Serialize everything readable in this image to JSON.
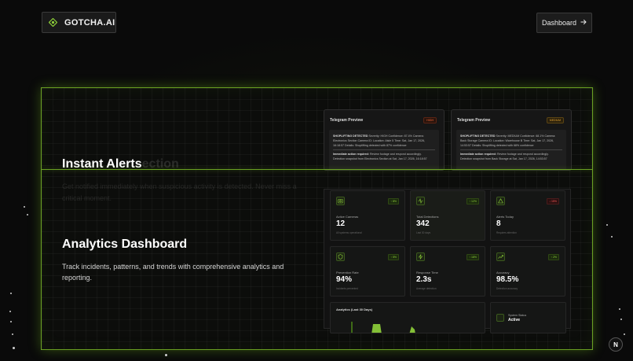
{
  "header": {
    "brand_name": "GOTCHA.AI",
    "brand_icon": "eye-diamond-icon",
    "dashboard_label": "Dashboard",
    "dashboard_icon": "arrow-right-icon"
  },
  "colors": {
    "accent": "#6aa022",
    "bright_accent": "#8fd13a",
    "danger": "#ff5a5a",
    "background": "#0b0b0b"
  },
  "prev_slide": {
    "title_visible": "Instant Alerts",
    "title_ghost": "ection",
    "description": "Get notified immediately when suspicious activity is detected. Never miss a critical moment.",
    "cards": [
      {
        "title": "Telegram Preview",
        "severity": "HIGH",
        "line1": "SHOPLIFTING DETECTED",
        "line1b": "Severity: HIGH",
        "line1c": "Confidence: 87.4%",
        "line2": "Camera: Electronics Section",
        "line2b": "Camera ID:",
        "line2c": "Location: Aisle 5",
        "line3": "Time: Sat, Jan 17, 2026, 16:18:57",
        "line3b": "Details: Shoplifting detected with 87% confidence",
        "action": "Immediate action required:",
        "action_text": "Review footage and respond accordingly.",
        "footer": "Detection snapshot from Electronics Section at Sat, Jan 17, 2026, 16:18:57"
      },
      {
        "title": "Telegram Preview",
        "severity": "MEDIUM",
        "line1": "SHOPLIFTING DETECTED",
        "line1b": "Severity: MEDIUM",
        "line1c": "Confidence: 68.1%",
        "line2": "Camera: Back Storage",
        "line2b": "Camera ID:",
        "line2c": "Location: Warehouse B",
        "line3": "Time: Sat, Jan 17, 2026, 14:53:57",
        "line3b": "Details: Shoplifting detected with 68% confidence",
        "action": "Immediate action required:",
        "action_text": "Review footage and respond accordingly.",
        "footer": "Detection snapshot from Back Storage at Sat, Jan 17, 2026, 14:53:57"
      }
    ]
  },
  "analytics": {
    "title": "Analytics Dashboard",
    "description": "Track incidents, patterns, and trends with comprehensive analytics and reporting.",
    "stats": [
      {
        "label": "Active Cameras",
        "value": "12",
        "sub": "All systems operational",
        "change": "↑ 8%",
        "dir": "up",
        "icon": "camera-icon"
      },
      {
        "label": "Total Detections",
        "value": "342",
        "sub": "Last 30 days",
        "change": "↑ 12%",
        "dir": "up",
        "icon": "activity-icon"
      },
      {
        "label": "Alerts Today",
        "value": "8",
        "sub": "Requires attention",
        "change": "↓ 15%",
        "dir": "down",
        "icon": "alert-triangle-icon"
      },
      {
        "label": "Prevention Rate",
        "value": "94%",
        "sub": "Incidents prevented",
        "change": "↑ 5%",
        "dir": "up",
        "icon": "shield-icon"
      },
      {
        "label": "Response Time",
        "value": "2.3s",
        "sub": "Average detection",
        "change": "↑ 18%",
        "dir": "up",
        "icon": "zap-icon"
      },
      {
        "label": "Accuracy",
        "value": "98.5%",
        "sub": "Detection accuracy",
        "change": "↑ 2%",
        "dir": "up",
        "icon": "trending-up-icon"
      }
    ],
    "chart_title": "Analytics (Last 30 Days)",
    "status_label": "System Status",
    "status_value": "Active"
  },
  "corner_badge": "N"
}
